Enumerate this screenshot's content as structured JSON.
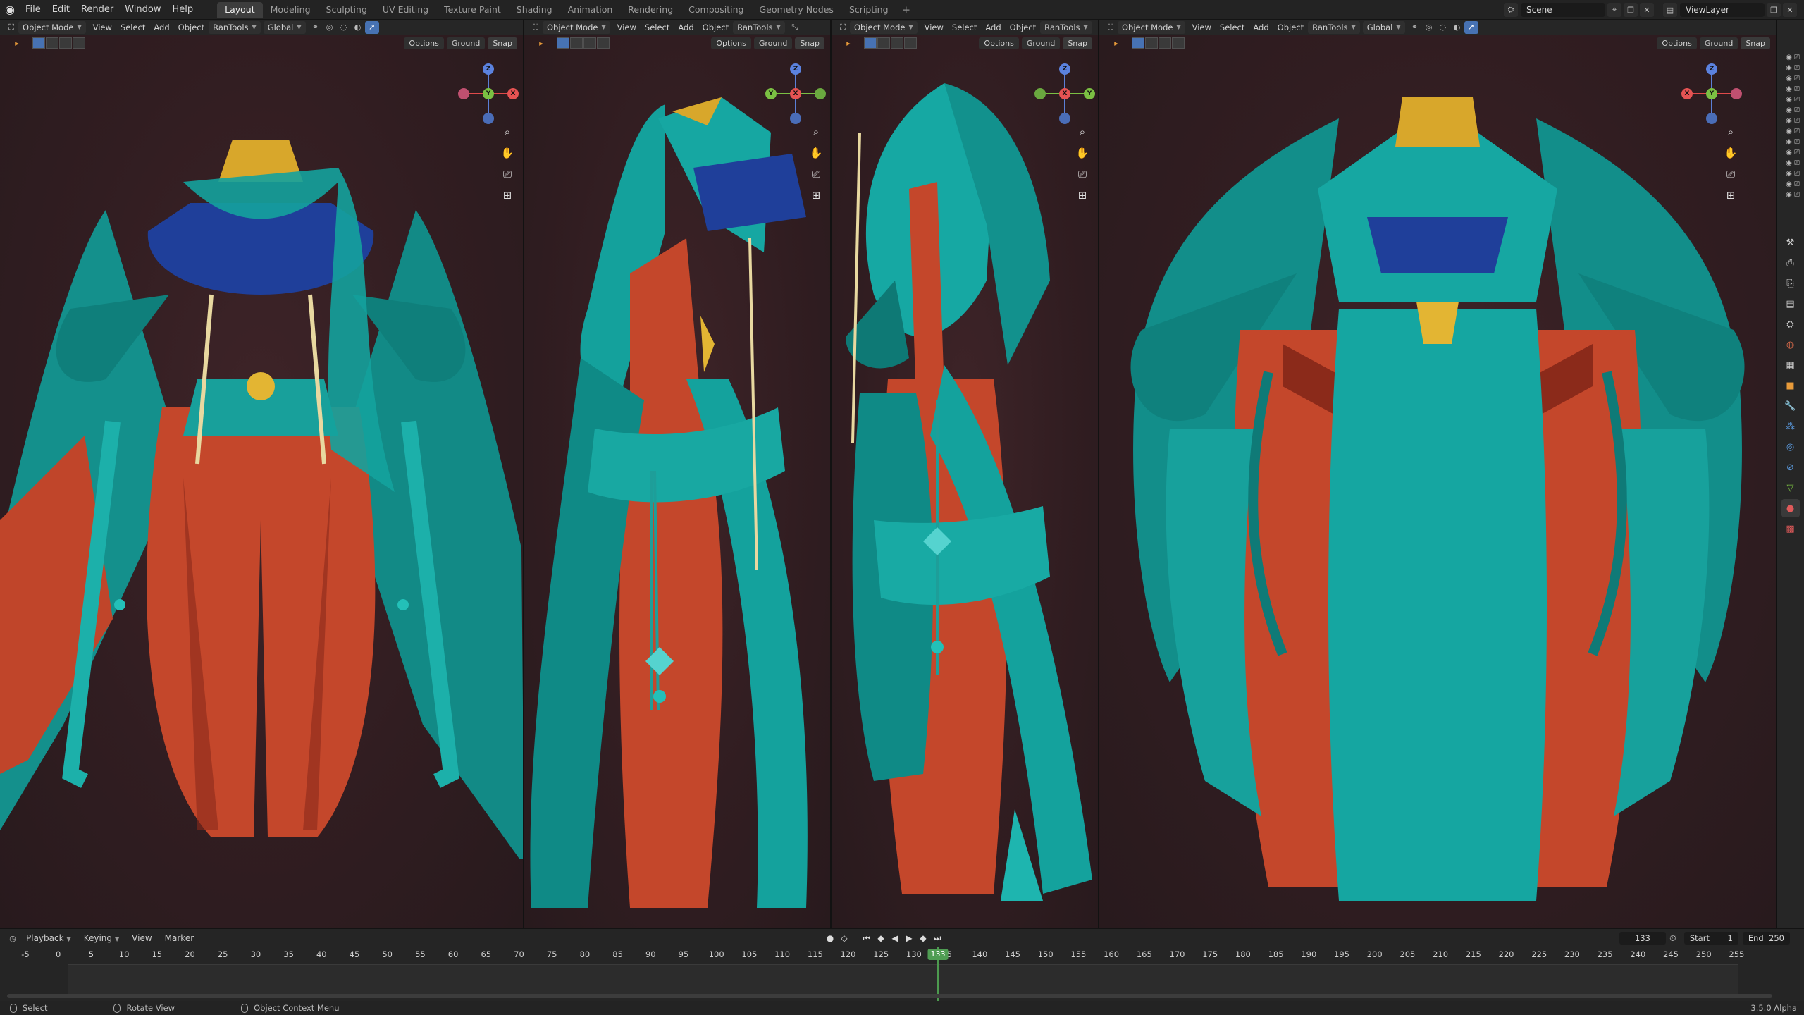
{
  "topbar": {
    "menus": [
      "File",
      "Edit",
      "Render",
      "Window",
      "Help"
    ],
    "workspaces": [
      "Layout",
      "Modeling",
      "Sculpting",
      "UV Editing",
      "Texture Paint",
      "Shading",
      "Animation",
      "Rendering",
      "Compositing",
      "Geometry Nodes",
      "Scripting"
    ],
    "active_workspace": "Layout",
    "add_workspace": "+",
    "scene": "Scene",
    "view_layer": "ViewLayer"
  },
  "viewport_header": {
    "mode": "Object Mode",
    "menus": [
      "View",
      "Select",
      "Add",
      "Object",
      "RanTools"
    ],
    "transform": "Global",
    "options": "Options",
    "ground": "Ground",
    "snap": "Snap"
  },
  "gizmo": {
    "x": "X",
    "y": "Y",
    "z": "Z"
  },
  "icons": {
    "zoom": "magnifier-icon",
    "pan": "hand-icon",
    "camera": "camera-icon",
    "grid": "grid-icon"
  },
  "colors": {
    "teal": "#1c9c98",
    "teal_dark": "#0f5a58",
    "rust": "#c4472b",
    "rust_dark": "#8b2a1a",
    "gold": "#d8a72b",
    "blue": "#1f3f9a",
    "bg": "#321e22",
    "accent": "#4772b3",
    "frame_green": "#4f9d53"
  },
  "timeline": {
    "menus": [
      "Playback",
      "Keying",
      "View",
      "Marker"
    ],
    "current_frame": "133",
    "start_label": "Start",
    "start": "1",
    "end_label": "End",
    "end": "250",
    "ticks": [
      "-5",
      "0",
      "5",
      "10",
      "15",
      "20",
      "25",
      "30",
      "35",
      "40",
      "45",
      "50",
      "55",
      "60",
      "65",
      "70",
      "75",
      "80",
      "85",
      "90",
      "95",
      "100",
      "105",
      "110",
      "115",
      "120",
      "125",
      "130",
      "35",
      "140",
      "145",
      "150",
      "155",
      "160",
      "165",
      "170",
      "175",
      "180",
      "185",
      "190",
      "195",
      "200",
      "205",
      "210",
      "215",
      "220",
      "225",
      "230",
      "235",
      "240",
      "245",
      "250",
      "255"
    ]
  },
  "statusbar": {
    "select": "Select",
    "rotate": "Rotate View",
    "context": "Object Context Menu",
    "version": "3.5.0 Alpha"
  }
}
